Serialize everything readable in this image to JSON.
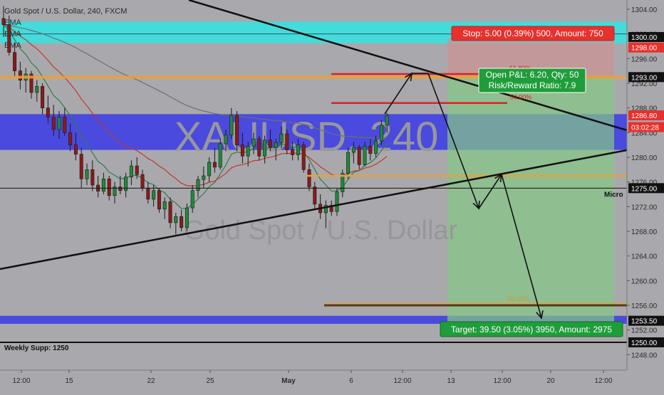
{
  "header": {
    "title": "Gold Spot / U.S. Dollar, 240, FXCM",
    "indicators": [
      "EMA",
      "EMA",
      "EMA"
    ]
  },
  "watermark": {
    "symbol": "XAUUSD, 240",
    "name": "Gold Spot / U.S. Dollar"
  },
  "colors": {
    "background": "#a9a9ad",
    "up_candle": "#1f8a3a",
    "down_candle": "#8b1a1a",
    "supply_zone": "#39e0e0",
    "demand_zone": "#3a3ae8",
    "stop_zone": "#d98b8b",
    "target_zone": "#84c784",
    "orange_line": "#f0a030",
    "red_line": "#e02020",
    "trend_line": "#111111"
  },
  "price_axis": {
    "ticks": [
      "1304.00",
      "1300.00",
      "1296.00",
      "1292.00",
      "1288.00",
      "1284.00",
      "1280.00",
      "1276.00",
      "1272.00",
      "1268.00",
      "1264.00",
      "1260.00",
      "1256.00",
      "1252.00",
      "1248.00"
    ],
    "tags": [
      {
        "label": "1300.00",
        "price": 1299.5,
        "style": "dark"
      },
      {
        "label": "1298.00",
        "price": 1297.8,
        "style": "red"
      },
      {
        "label": "1293.00",
        "price": 1293.0,
        "style": "dark"
      },
      {
        "label": "1286.80",
        "price": 1286.8,
        "style": "red"
      },
      {
        "label": "03:02:28",
        "price": 1284.9,
        "style": "red"
      },
      {
        "label": "1275.00",
        "price": 1275.0,
        "style": "dark"
      },
      {
        "label": "1253.50",
        "price": 1253.5,
        "style": "dark"
      },
      {
        "label": "1250.00",
        "price": 1250.0,
        "style": "dark"
      }
    ],
    "range": [
      1245.5,
      1305.5
    ]
  },
  "time_axis": {
    "labels": [
      "12:00",
      "15",
      "22",
      "25",
      "May",
      "6",
      "12:00",
      "13",
      "12:00",
      "20",
      "12:00"
    ]
  },
  "zones": {
    "supply": {
      "top": 1302.0,
      "bottom": 1298.5
    },
    "supply_line": 1300.0,
    "demand": {
      "top": 1287.0,
      "bottom": 1281.2
    },
    "weekly_demand": {
      "top": 1254.3,
      "bottom": 1253.0
    }
  },
  "levels": {
    "orange_upper": 1293.0,
    "orange_lower": 1277.0,
    "micro": 1275.0,
    "weekly_support": 1250.0,
    "fib_618": 1293.5,
    "fib_500": 1288.8,
    "fib_lower": 1256.0
  },
  "labels": {
    "micro": "Micro",
    "weekly_support": "Weekly Supp: 1250",
    "fib_618": "61.80%",
    "fib_500": "50.00%",
    "fib_lower": "50.00%"
  },
  "position": {
    "stop_text": "Stop: 5.00 (0.39%) 500, Amount: 750",
    "pnl_line1": "Open P&L: 6.20, Qty: 50",
    "pnl_line2": "Risk/Reward Ratio: 7.9",
    "target_text": "Target: 39.50 (3.05%) 3950, Amount: 2975",
    "entry": 1293.0,
    "stop": 1298.0,
    "target": 1253.5
  },
  "chart_data": {
    "type": "candlestick",
    "title": "Gold Spot / U.S. Dollar, 240, FXCM",
    "ylim": [
      1245.5,
      1305.5
    ],
    "candles": [
      [
        1302.5,
        1304.5,
        1299.5,
        1301.5
      ],
      [
        1301.5,
        1303.0,
        1296.5,
        1297.0
      ],
      [
        1297.0,
        1298.5,
        1293.0,
        1294.0
      ],
      [
        1294.0,
        1295.5,
        1291.0,
        1292.5
      ],
      [
        1292.5,
        1294.5,
        1290.5,
        1293.5
      ],
      [
        1293.5,
        1294.0,
        1289.5,
        1290.5
      ],
      [
        1290.5,
        1292.5,
        1289.0,
        1291.5
      ],
      [
        1291.5,
        1292.0,
        1287.0,
        1288.0
      ],
      [
        1288.0,
        1290.0,
        1285.5,
        1286.5
      ],
      [
        1286.5,
        1288.5,
        1283.5,
        1284.5
      ],
      [
        1284.5,
        1287.5,
        1283.0,
        1286.5
      ],
      [
        1286.5,
        1288.0,
        1283.5,
        1284.0
      ],
      [
        1284.0,
        1285.5,
        1281.0,
        1282.0
      ],
      [
        1282.0,
        1284.0,
        1279.5,
        1280.5
      ],
      [
        1280.5,
        1281.5,
        1275.0,
        1276.5
      ],
      [
        1276.5,
        1279.0,
        1275.5,
        1278.0
      ],
      [
        1278.0,
        1279.5,
        1274.5,
        1275.5
      ],
      [
        1275.5,
        1277.0,
        1273.5,
        1274.5
      ],
      [
        1274.5,
        1277.5,
        1274.0,
        1276.5
      ],
      [
        1276.5,
        1277.0,
        1273.0,
        1273.8
      ],
      [
        1273.8,
        1276.0,
        1272.5,
        1275.2
      ],
      [
        1275.2,
        1277.0,
        1274.0,
        1274.6
      ],
      [
        1274.6,
        1277.5,
        1273.5,
        1276.8
      ],
      [
        1276.8,
        1279.5,
        1275.5,
        1278.6
      ],
      [
        1278.6,
        1280.0,
        1276.5,
        1277.2
      ],
      [
        1277.2,
        1278.0,
        1274.5,
        1275.0
      ],
      [
        1275.0,
        1276.0,
        1272.5,
        1273.2
      ],
      [
        1273.2,
        1275.5,
        1272.0,
        1274.6
      ],
      [
        1274.6,
        1275.0,
        1271.0,
        1271.6
      ],
      [
        1271.6,
        1273.5,
        1270.0,
        1272.8
      ],
      [
        1272.8,
        1273.5,
        1268.5,
        1269.4
      ],
      [
        1269.4,
        1271.0,
        1267.5,
        1270.4
      ],
      [
        1270.4,
        1271.5,
        1268.0,
        1268.6
      ],
      [
        1268.6,
        1272.5,
        1268.0,
        1271.8
      ],
      [
        1271.8,
        1275.5,
        1271.0,
        1274.6
      ],
      [
        1274.6,
        1277.0,
        1273.5,
        1276.4
      ],
      [
        1276.4,
        1278.5,
        1275.0,
        1277.0
      ],
      [
        1277.0,
        1280.0,
        1276.0,
        1279.2
      ],
      [
        1279.2,
        1281.5,
        1277.5,
        1278.4
      ],
      [
        1278.4,
        1283.0,
        1278.0,
        1282.2
      ],
      [
        1282.2,
        1284.5,
        1281.0,
        1283.6
      ],
      [
        1283.6,
        1288.0,
        1283.0,
        1286.8
      ],
      [
        1286.8,
        1287.5,
        1281.0,
        1282.0
      ],
      [
        1282.0,
        1284.0,
        1279.0,
        1280.2
      ],
      [
        1280.2,
        1282.5,
        1278.5,
        1281.8
      ],
      [
        1281.8,
        1284.0,
        1280.5,
        1283.0
      ],
      [
        1283.0,
        1283.5,
        1279.5,
        1280.2
      ],
      [
        1280.2,
        1283.5,
        1279.0,
        1282.8
      ],
      [
        1282.8,
        1284.5,
        1281.0,
        1281.6
      ],
      [
        1281.6,
        1283.0,
        1279.5,
        1282.4
      ],
      [
        1282.4,
        1285.0,
        1281.5,
        1283.8
      ],
      [
        1283.8,
        1284.5,
        1280.5,
        1281.2
      ],
      [
        1281.2,
        1282.5,
        1279.5,
        1280.4
      ],
      [
        1280.4,
        1283.0,
        1279.5,
        1282.0
      ],
      [
        1282.0,
        1282.5,
        1277.5,
        1278.0
      ],
      [
        1278.0,
        1279.0,
        1274.5,
        1275.2
      ],
      [
        1275.2,
        1276.0,
        1271.5,
        1272.4
      ],
      [
        1272.4,
        1274.0,
        1270.0,
        1271.0
      ],
      [
        1271.0,
        1273.0,
        1268.5,
        1272.2
      ],
      [
        1272.2,
        1273.0,
        1270.5,
        1271.2
      ],
      [
        1271.2,
        1275.0,
        1270.5,
        1274.4
      ],
      [
        1274.4,
        1278.0,
        1273.5,
        1277.4
      ],
      [
        1277.4,
        1281.5,
        1276.5,
        1280.8
      ],
      [
        1280.8,
        1282.5,
        1279.0,
        1281.6
      ],
      [
        1281.6,
        1282.0,
        1278.0,
        1278.8
      ],
      [
        1278.8,
        1282.5,
        1278.5,
        1281.8
      ],
      [
        1281.8,
        1283.0,
        1279.5,
        1280.6
      ],
      [
        1280.6,
        1283.5,
        1280.0,
        1282.6
      ],
      [
        1282.6,
        1286.0,
        1282.0,
        1285.2
      ],
      [
        1285.2,
        1287.2,
        1284.0,
        1286.8
      ]
    ]
  }
}
